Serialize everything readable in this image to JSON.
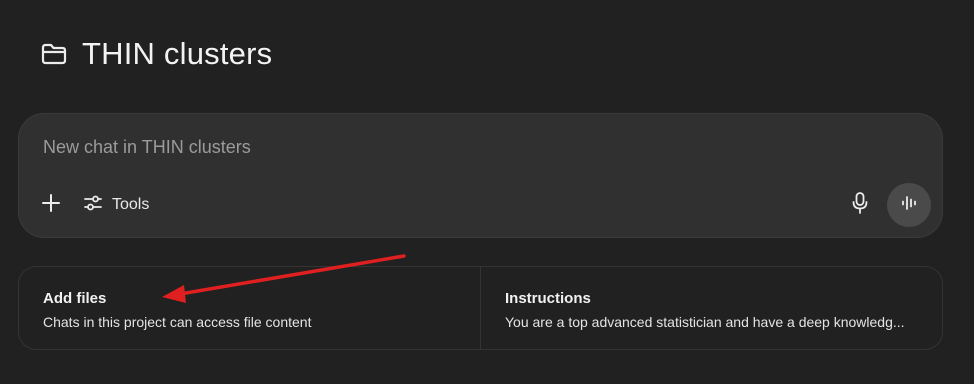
{
  "project": {
    "title": "THIN clusters",
    "icon": "folder-icon"
  },
  "composer": {
    "placeholder": "New chat in THIN clusters",
    "add_icon": "plus-icon",
    "tools_label": "Tools",
    "tools_icon": "sliders-icon",
    "mic_icon": "microphone-icon",
    "voice_icon": "voice-wave-icon"
  },
  "cards": {
    "add_files": {
      "title": "Add files",
      "description": "Chats in this project can access file content"
    },
    "instructions": {
      "title": "Instructions",
      "description": "You are a top advanced statistician and have a deep knowledg..."
    }
  },
  "annotation": {
    "arrow_color": "#e02020"
  }
}
